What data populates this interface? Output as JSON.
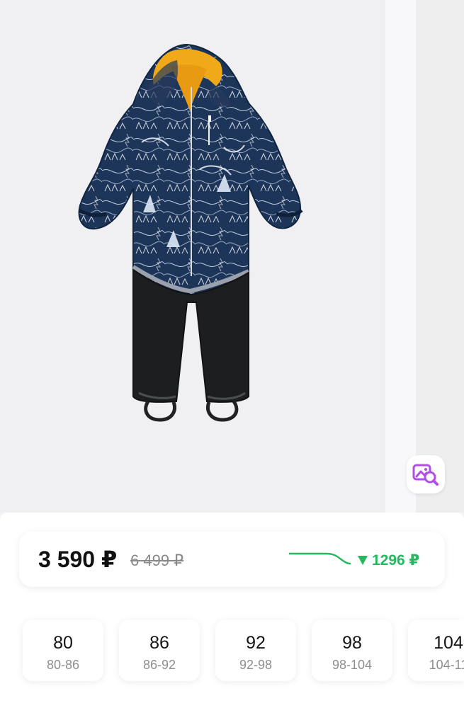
{
  "price": {
    "current": "3 590 ₽",
    "old": "6 499 ₽",
    "drop": "1296 ₽"
  },
  "sizes": [
    {
      "size": "80",
      "range": "80-86"
    },
    {
      "size": "86",
      "range": "86-92"
    },
    {
      "size": "92",
      "range": "92-98"
    },
    {
      "size": "98",
      "range": "98-104"
    },
    {
      "size": "104",
      "range": "104-11"
    }
  ],
  "icons": {
    "image_search": "image-search-icon",
    "price_trend": "price-trend-icon",
    "price_drop": "down-arrow-icon"
  },
  "colors": {
    "accent": "#26b85f",
    "image_search": "#b14ee8",
    "jacket": "#1d3559",
    "pants": "#1d1e20",
    "collar": "#f1ad1b"
  }
}
